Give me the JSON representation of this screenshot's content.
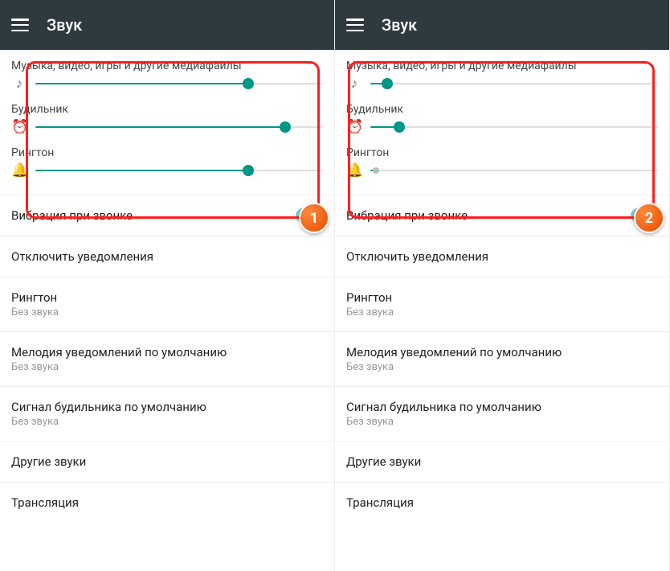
{
  "header": {
    "title": "Звук"
  },
  "sliders": {
    "media": {
      "label": "Музыка, видео, игры и другие медиафайлы"
    },
    "alarm": {
      "label": "Будильник"
    },
    "ring": {
      "label": "Рингтон"
    }
  },
  "left": {
    "media_pct": 74,
    "alarm_pct": 87,
    "ring_pct": 74
  },
  "right": {
    "media_pct": 6,
    "alarm_pct": 10,
    "ring_pct": 2
  },
  "rows": {
    "vibrate": {
      "title": "Вибрация при звонке"
    },
    "dnd": {
      "title": "Отключить уведомления"
    },
    "ringtone": {
      "title": "Рингтон",
      "sub": "Без звука"
    },
    "notif": {
      "title": "Мелодия уведомлений по умолчанию",
      "sub": "Без звука"
    },
    "alarm_tone": {
      "title": "Сигнал будильника по умолчанию",
      "sub": "Без звука"
    },
    "other": {
      "title": "Другие звуки"
    },
    "cast": {
      "title": "Трансляция"
    }
  },
  "badges": {
    "left": "1",
    "right": "2"
  }
}
